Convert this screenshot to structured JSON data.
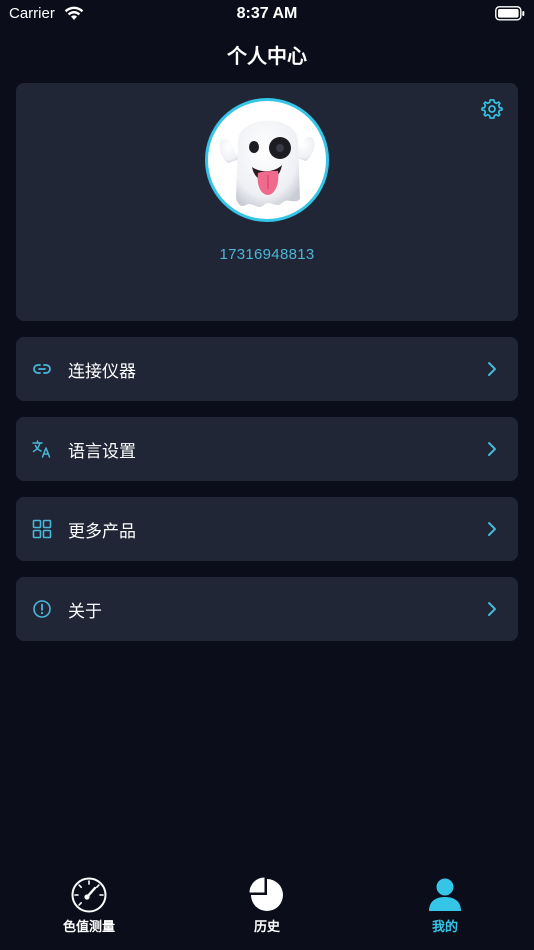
{
  "status_bar": {
    "carrier": "Carrier",
    "time": "8:37 AM"
  },
  "nav": {
    "title": "个人中心"
  },
  "profile": {
    "phone": "17316948813",
    "avatar_icon": "ghost-avatar"
  },
  "menu": [
    {
      "label": "连接仪器",
      "icon": "link-icon"
    },
    {
      "label": "语言设置",
      "icon": "translate-icon"
    },
    {
      "label": "更多产品",
      "icon": "grid-icon"
    },
    {
      "label": "关于",
      "icon": "info-icon"
    }
  ],
  "tabs": [
    {
      "label": "色值测量",
      "icon": "gauge-icon",
      "active": false
    },
    {
      "label": "历史",
      "icon": "pie-chart-icon",
      "active": false
    },
    {
      "label": "我的",
      "icon": "user-icon",
      "active": true
    }
  ],
  "colors": {
    "accent": "#35c5e6",
    "card": "#212637",
    "background": "#0b0e1a",
    "phone_text": "#4bb6d8"
  }
}
